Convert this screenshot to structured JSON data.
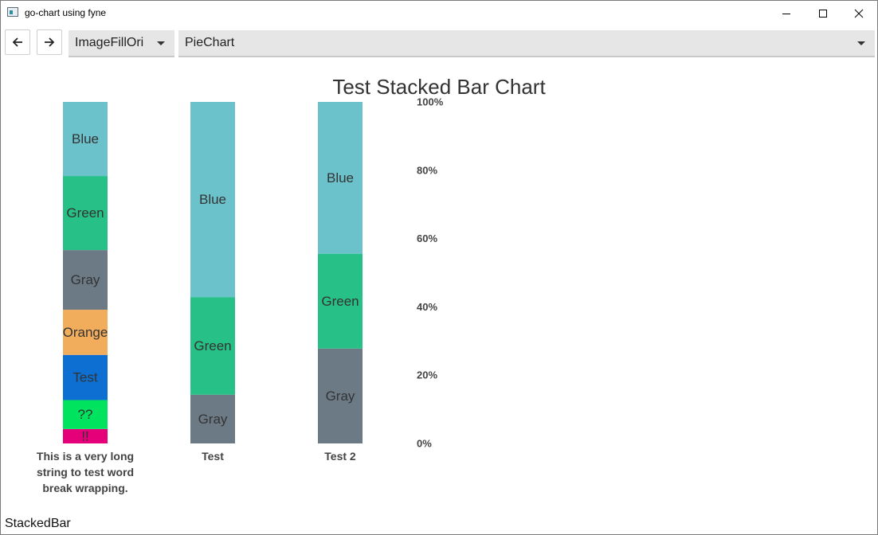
{
  "window": {
    "title": "go-chart using fyne"
  },
  "toolbar": {
    "fill_mode": "ImageFillOri",
    "chart_type": "PieChart"
  },
  "status_text": "StackedBar",
  "chart_data": {
    "type": "bar",
    "stacked": true,
    "title": "Test Stacked Bar Chart",
    "yticks": [
      "0%",
      "20%",
      "40%",
      "60%",
      "80%",
      "100%"
    ],
    "ylim": [
      0,
      100
    ],
    "bars": [
      {
        "name": "This is a very long string to test word break wrapping.",
        "label_lines": [
          "This is a very long",
          "string to test word",
          "break wrapping."
        ],
        "segments": [
          {
            "label": "!!",
            "value": 0.4,
            "color": "#e5007a"
          },
          {
            "label": "??",
            "value": 0.8,
            "color": "#00e35f"
          },
          {
            "label": "Test",
            "value": 1.25,
            "color": "#0d6fd1"
          },
          {
            "label": "Orange",
            "value": 1.25,
            "color": "#f2ad5c"
          },
          {
            "label": "Gray",
            "value": 1.65,
            "color": "#6c7a86"
          },
          {
            "label": "Green",
            "value": 2.05,
            "color": "#27c087"
          },
          {
            "label": "Blue",
            "value": 2.05,
            "color": "#6bc2cb"
          }
        ]
      },
      {
        "name": "Test",
        "label_lines": [
          "Test"
        ],
        "segments": [
          {
            "label": "Gray",
            "value": 0.25,
            "color": "#6c7a86"
          },
          {
            "label": "Green",
            "value": 0.5,
            "color": "#27c087"
          },
          {
            "label": "Blue",
            "value": 1.0,
            "color": "#6bc2cb"
          }
        ]
      },
      {
        "name": "Test 2",
        "label_lines": [
          "Test 2"
        ],
        "segments": [
          {
            "label": "Gray",
            "value": 0.25,
            "color": "#6c7a86"
          },
          {
            "label": "Green",
            "value": 0.25,
            "color": "#27c087"
          },
          {
            "label": "Blue",
            "value": 0.4,
            "color": "#6bc2cb"
          }
        ]
      }
    ]
  }
}
